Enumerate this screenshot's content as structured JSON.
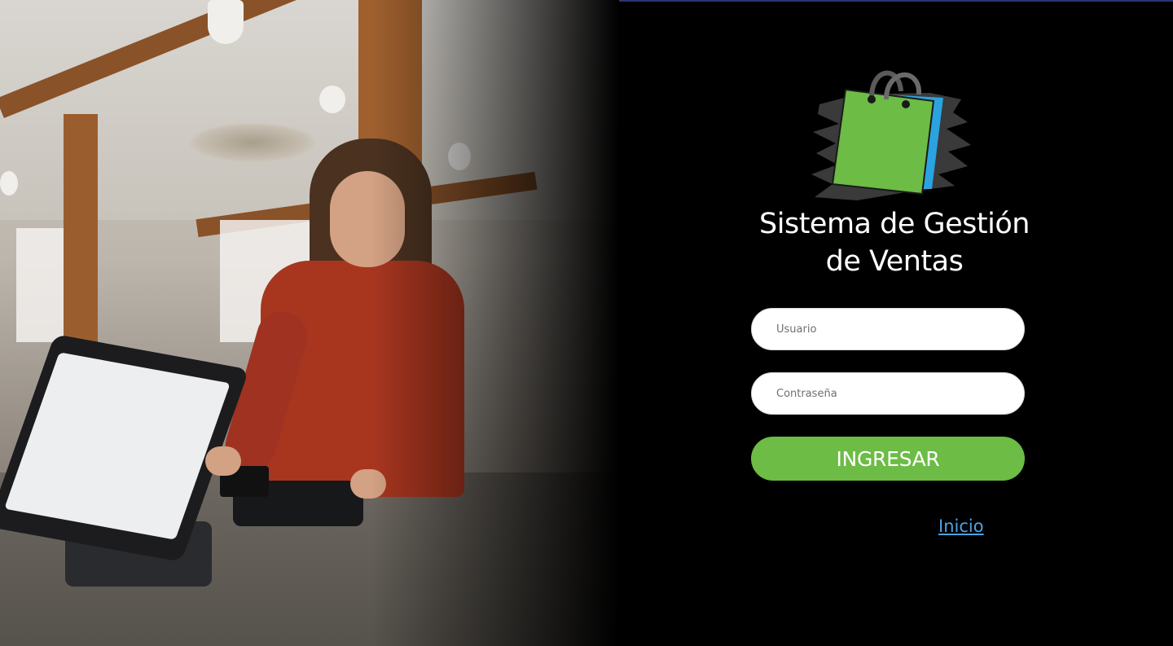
{
  "app": {
    "title": "Sistema de Gestión de Ventas",
    "title_line1": "Sistema de Gestión",
    "title_line2": "de Ventas",
    "logo_icon": "shopping-bag-icon"
  },
  "login": {
    "username_placeholder": "Usuario",
    "password_placeholder": "Contraseña",
    "submit_label": "INGRESAR",
    "home_link_label": "Inicio"
  },
  "colors": {
    "background": "#000000",
    "accent_green": "#6cbc45",
    "bag_blue": "#2aa3e0",
    "link_blue": "#4ba3e6",
    "text": "#ffffff"
  }
}
